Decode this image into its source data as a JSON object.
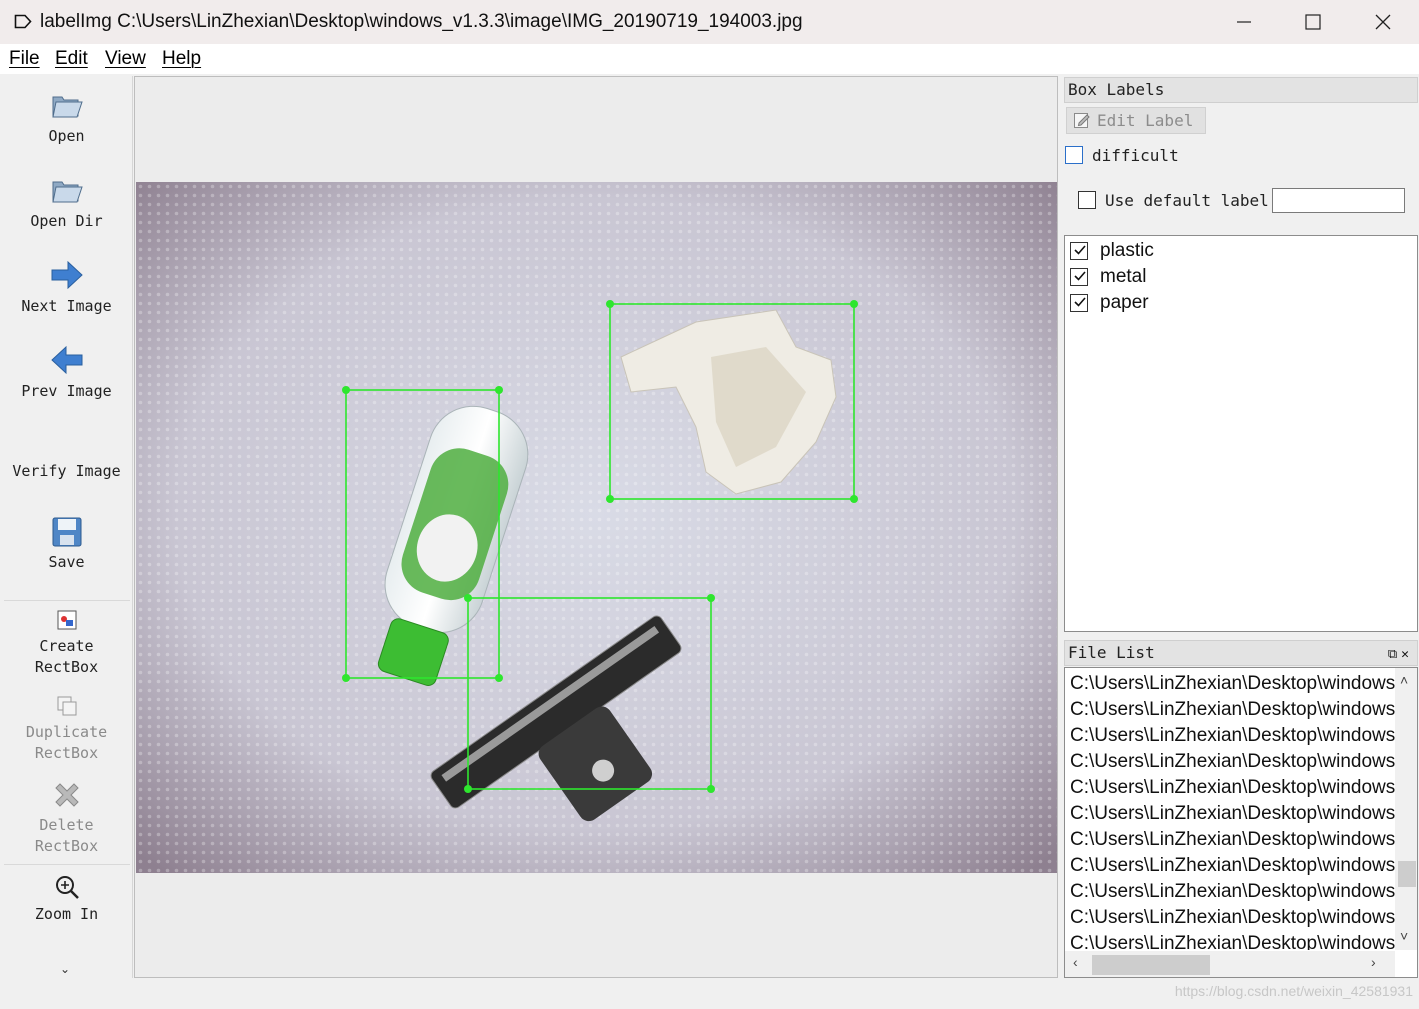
{
  "window": {
    "title": "labelImg C:\\Users\\LinZhexian\\Desktop\\windows_v1.3.3\\image\\IMG_20190719_194003.jpg",
    "icons": {
      "app": "label-tag-icon",
      "minimize": "minimize-icon",
      "maximize": "maximize-icon",
      "close": "close-icon"
    }
  },
  "menu": [
    "File",
    "Edit",
    "View",
    "Help"
  ],
  "toolbar": {
    "open": "Open",
    "open_dir": "Open Dir",
    "next_image": "Next Image",
    "prev_image": "Prev Image",
    "verify_image": "Verify Image",
    "save": "Save",
    "create_rectbox": [
      "Create",
      "RectBox"
    ],
    "duplicate_rectbox": [
      "Duplicate",
      "RectBox"
    ],
    "delete_rectbox": [
      "Delete",
      "RectBox"
    ],
    "zoom_in": "Zoom In"
  },
  "box_labels": {
    "title": "Box Labels",
    "edit_label_button": "Edit Label",
    "difficult": {
      "label": "difficult",
      "checked": false
    },
    "use_default_label": {
      "label": "Use default label",
      "checked": false,
      "value": ""
    },
    "labels": [
      {
        "name": "plastic",
        "checked": true
      },
      {
        "name": "metal",
        "checked": true
      },
      {
        "name": "paper",
        "checked": true
      }
    ]
  },
  "file_list": {
    "title": "File List",
    "items": [
      "C:\\Users\\LinZhexian\\Desktop\\windows",
      "C:\\Users\\LinZhexian\\Desktop\\windows",
      "C:\\Users\\LinZhexian\\Desktop\\windows",
      "C:\\Users\\LinZhexian\\Desktop\\windows",
      "C:\\Users\\LinZhexian\\Desktop\\windows",
      "C:\\Users\\LinZhexian\\Desktop\\windows",
      "C:\\Users\\LinZhexian\\Desktop\\windows",
      "C:\\Users\\LinZhexian\\Desktop\\windows",
      "C:\\Users\\LinZhexian\\Desktop\\windows",
      "C:\\Users\\LinZhexian\\Desktop\\windows",
      "C:\\Users\\LinZhexian\\Desktop\\windows"
    ]
  },
  "statusbar": {
    "watermark": "https://blog.csdn.net/weixin_42581931"
  },
  "colors": {
    "bbox": "#2ee62e",
    "accent_blue": "#2b6fc9",
    "titlebar": "#f1ecec"
  }
}
